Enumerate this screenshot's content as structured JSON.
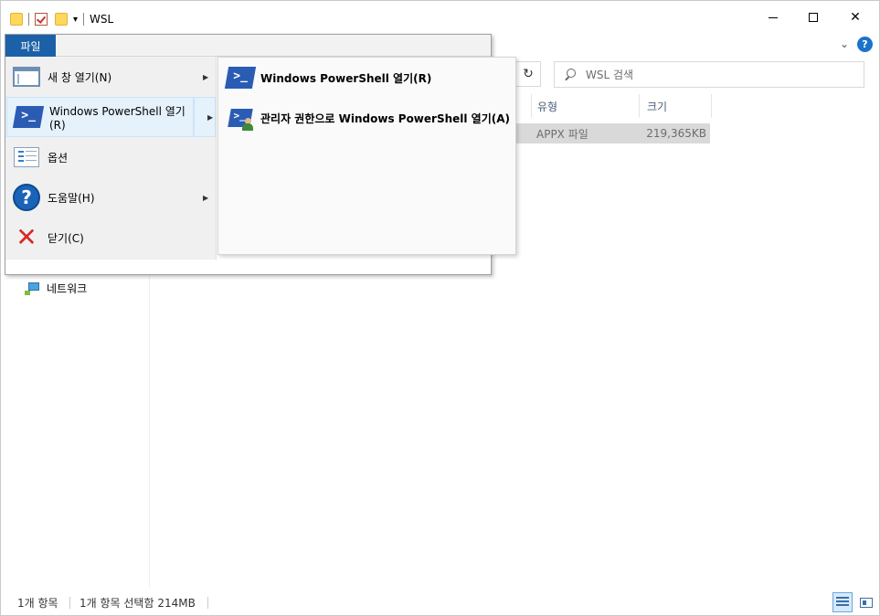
{
  "window": {
    "title": "WSL"
  },
  "search": {
    "placeholder": "WSL 검색"
  },
  "columns": {
    "type": "유형",
    "size": "크기"
  },
  "file_row": {
    "type": "APPX 파일",
    "size": "219,365KB"
  },
  "navigation": {
    "network": "네트워크"
  },
  "status": {
    "item_count": "1개 항목",
    "selection": "1개 항목 선택함 214MB"
  },
  "file_menu": {
    "tab_label": "파일",
    "items": [
      {
        "label": "새 창 열기(N)",
        "icon": "new-window-icon",
        "has_submenu": true
      },
      {
        "label": "Windows PowerShell 열기(R)",
        "icon": "powershell-icon",
        "has_submenu": true,
        "active": true
      },
      {
        "label": "옵션",
        "icon": "options-icon",
        "has_submenu": false
      },
      {
        "label": "도움말(H)",
        "icon": "help-icon",
        "has_submenu": true
      },
      {
        "label": "닫기(C)",
        "icon": "close-icon",
        "has_submenu": false
      }
    ],
    "submenu": [
      {
        "label": "Windows PowerShell 열기(R)",
        "icon": "powershell-icon"
      },
      {
        "label": "관리자 권한으로 Windows PowerShell 열기(A)",
        "icon": "powershell-admin-icon"
      }
    ]
  },
  "colors": {
    "file_tab": "#1c61a8",
    "active_item": "#e5f1fb",
    "selected_row": "#d9d9d9",
    "powershell": "#2b5cb4",
    "close_x": "#d42a2a"
  }
}
